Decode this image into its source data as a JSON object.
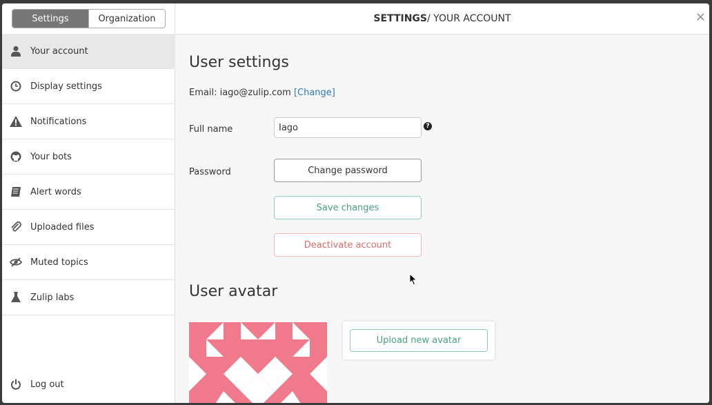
{
  "tabs": {
    "settings": "Settings",
    "organization": "Organization"
  },
  "header": {
    "strong": "SETTINGS",
    "rest": " / YOUR ACCOUNT",
    "close": "×"
  },
  "sidebar": {
    "items": [
      {
        "label": "Your account",
        "icon": "user-icon"
      },
      {
        "label": "Display settings",
        "icon": "clock-icon"
      },
      {
        "label": "Notifications",
        "icon": "warning-icon"
      },
      {
        "label": "Your bots",
        "icon": "github-icon"
      },
      {
        "label": "Alert words",
        "icon": "book-icon"
      },
      {
        "label": "Uploaded files",
        "icon": "paperclip-icon"
      },
      {
        "label": "Muted topics",
        "icon": "eye-slash-icon"
      },
      {
        "label": "Zulip labs",
        "icon": "flask-icon"
      }
    ],
    "logout": "Log out"
  },
  "user_settings": {
    "title": "User settings",
    "email_prefix": "Email: iago@zulip.com",
    "change_link": "[Change]",
    "full_name_label": "Full name",
    "full_name_value": "Iago",
    "help": "?",
    "password_label": "Password",
    "change_password": "Change password",
    "save_changes": "Save changes",
    "deactivate": "Deactivate account"
  },
  "avatar": {
    "title": "User avatar",
    "upload": "Upload new avatar",
    "color": "#f07a8b"
  }
}
